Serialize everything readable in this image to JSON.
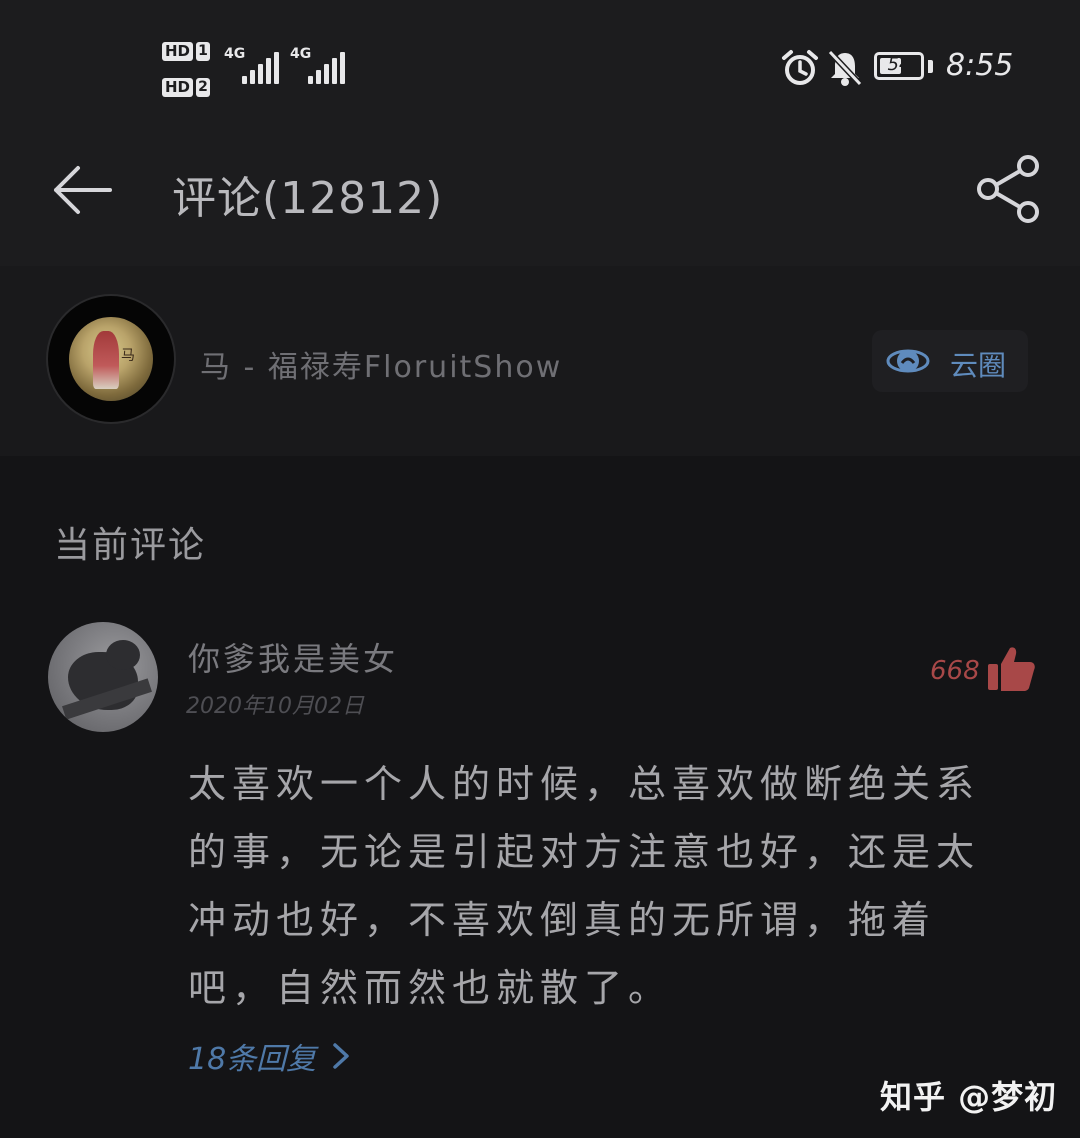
{
  "status_bar": {
    "sim1_hd": "HD",
    "sim1_slot": "1",
    "sim2_hd": "HD",
    "sim2_slot": "2",
    "net1_label": "4G",
    "net2_label": "4G",
    "battery_level": "54",
    "battery_fraction": 0.54,
    "time": "8:55",
    "icons": [
      "alarm-icon",
      "bell-muted-icon",
      "battery-icon"
    ]
  },
  "header": {
    "title": "评论(12812)",
    "back_icon": "arrow-left-icon",
    "share_icon": "share-icon"
  },
  "circle": {
    "name": "马 - 福禄寿FloruitShow",
    "avatar_glyph": "马",
    "tag_label": "云圈",
    "tag_icon": "cloud-circle-icon"
  },
  "section": {
    "title": "当前评论"
  },
  "comment": {
    "author": "你爹我是美女",
    "date": "2020年10月02日",
    "likes": "668",
    "body": "太喜欢一个人的时候，总喜欢做断绝关系的事，无论是引起对方注意也好，还是太冲动也好，不喜欢倒真的无所谓，拖着吧，自然而然也就散了。",
    "replies": "18条回复"
  },
  "watermark": "知乎 @梦初",
  "colors": {
    "background": "#141416",
    "bar": "#1c1c1e",
    "like": "#a84848",
    "link": "#4f79a8",
    "tag": "#5f8bbd"
  }
}
